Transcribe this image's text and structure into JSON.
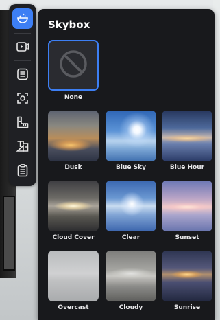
{
  "toolbar": {
    "items": [
      {
        "icon": "skybox-icon",
        "active": true
      },
      {
        "icon": "video-icon",
        "active": false
      },
      {
        "icon": "notes-icon",
        "active": false
      },
      {
        "icon": "scan-icon",
        "active": false
      },
      {
        "icon": "ruler-icon",
        "active": false
      },
      {
        "icon": "floorplan-icon",
        "active": false
      },
      {
        "icon": "clipboard-icon",
        "active": false
      }
    ]
  },
  "panel": {
    "title": "Skybox",
    "options": [
      {
        "label": "None",
        "selected": true
      },
      {
        "label": "Dusk",
        "selected": false
      },
      {
        "label": "Blue Sky",
        "selected": false
      },
      {
        "label": "Blue Hour",
        "selected": false
      },
      {
        "label": "Cloud Cover",
        "selected": false
      },
      {
        "label": "Clear",
        "selected": false
      },
      {
        "label": "Sunset",
        "selected": false
      },
      {
        "label": "Overcast",
        "selected": false
      },
      {
        "label": "Cloudy",
        "selected": false
      },
      {
        "label": "Sunrise",
        "selected": false
      }
    ]
  },
  "colors": {
    "accent": "#3d7ff4",
    "panel_bg": "#18191c",
    "toolbar_bg": "#1f2024",
    "label": "#e8e8ea"
  }
}
